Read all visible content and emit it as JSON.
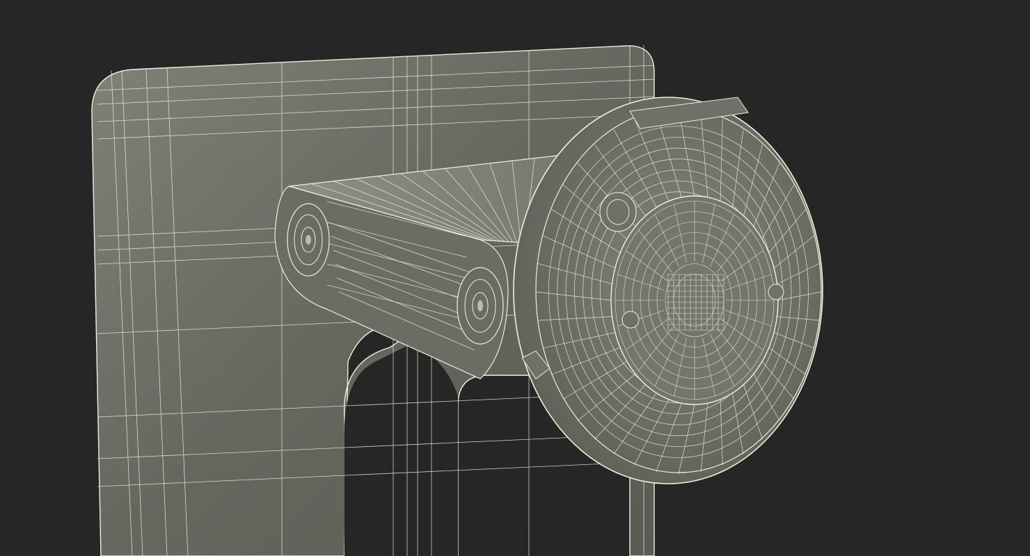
{
  "scene": {
    "background": "#262626",
    "surface_color": "#6e6f66",
    "surface_shadow": "#55564f",
    "surface_light": "#8a8b80",
    "wire_color": "#f1f1dc",
    "objects": [
      "mount-plate",
      "hinge-arm",
      "round-adapter-disc"
    ]
  }
}
